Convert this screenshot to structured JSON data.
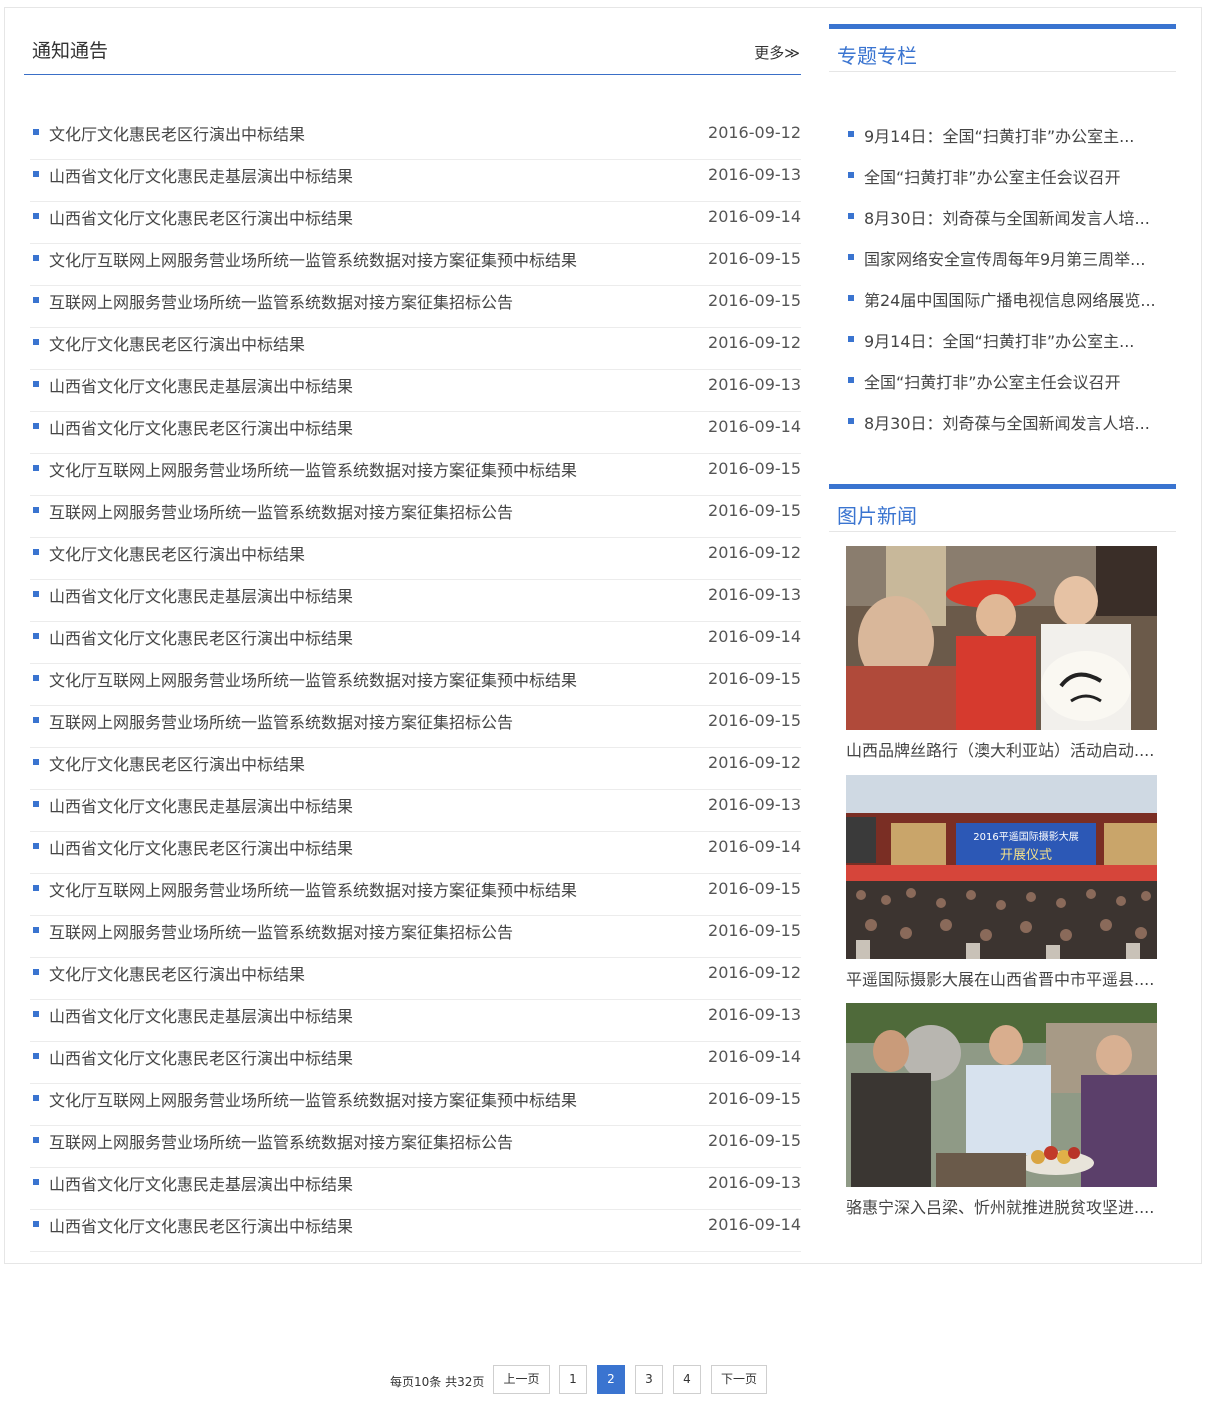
{
  "notices": {
    "title": "通知通告",
    "more_label": "更多≫",
    "items": [
      {
        "title": "文化厅文化惠民老区行演出中标结果",
        "date": "2016-09-12"
      },
      {
        "title": "山西省文化厅文化惠民走基层演出中标结果",
        "date": "2016-09-13"
      },
      {
        "title": "山西省文化厅文化惠民老区行演出中标结果",
        "date": "2016-09-14"
      },
      {
        "title": "文化厅互联网上网服务营业场所统一监管系统数据对接方案征集预中标结果",
        "date": "2016-09-15"
      },
      {
        "title": "互联网上网服务营业场所统一监管系统数据对接方案征集招标公告",
        "date": "2016-09-15"
      },
      {
        "title": "文化厅文化惠民老区行演出中标结果",
        "date": "2016-09-12"
      },
      {
        "title": "山西省文化厅文化惠民走基层演出中标结果",
        "date": "2016-09-13"
      },
      {
        "title": "山西省文化厅文化惠民老区行演出中标结果",
        "date": "2016-09-14"
      },
      {
        "title": "文化厅互联网上网服务营业场所统一监管系统数据对接方案征集预中标结果",
        "date": "2016-09-15"
      },
      {
        "title": "互联网上网服务营业场所统一监管系统数据对接方案征集招标公告",
        "date": "2016-09-15"
      },
      {
        "title": "文化厅文化惠民老区行演出中标结果",
        "date": "2016-09-12"
      },
      {
        "title": "山西省文化厅文化惠民走基层演出中标结果",
        "date": "2016-09-13"
      },
      {
        "title": "山西省文化厅文化惠民老区行演出中标结果",
        "date": "2016-09-14"
      },
      {
        "title": "文化厅互联网上网服务营业场所统一监管系统数据对接方案征集预中标结果",
        "date": "2016-09-15"
      },
      {
        "title": "互联网上网服务营业场所统一监管系统数据对接方案征集招标公告",
        "date": "2016-09-15"
      },
      {
        "title": "文化厅文化惠民老区行演出中标结果",
        "date": "2016-09-12"
      },
      {
        "title": "山西省文化厅文化惠民走基层演出中标结果",
        "date": "2016-09-13"
      },
      {
        "title": "山西省文化厅文化惠民老区行演出中标结果",
        "date": "2016-09-14"
      },
      {
        "title": "文化厅互联网上网服务营业场所统一监管系统数据对接方案征集预中标结果",
        "date": "2016-09-15"
      },
      {
        "title": "互联网上网服务营业场所统一监管系统数据对接方案征集招标公告",
        "date": "2016-09-15"
      },
      {
        "title": "文化厅文化惠民老区行演出中标结果",
        "date": "2016-09-12"
      },
      {
        "title": "山西省文化厅文化惠民走基层演出中标结果",
        "date": "2016-09-13"
      },
      {
        "title": "山西省文化厅文化惠民老区行演出中标结果",
        "date": "2016-09-14"
      },
      {
        "title": "文化厅互联网上网服务营业场所统一监管系统数据对接方案征集预中标结果",
        "date": "2016-09-15"
      },
      {
        "title": "互联网上网服务营业场所统一监管系统数据对接方案征集招标公告",
        "date": "2016-09-15"
      },
      {
        "title": "山西省文化厅文化惠民走基层演出中标结果",
        "date": "2016-09-13"
      },
      {
        "title": "山西省文化厅文化惠民老区行演出中标结果",
        "date": "2016-09-14"
      }
    ]
  },
  "topics": {
    "title": "专题专栏",
    "items": [
      "9月14日：全国“扫黄打非”办公室主...",
      "全国“扫黄打非”办公室主任会议召开",
      "8月30日：刘奇葆与全国新闻发言人培...",
      "国家网络安全宣传周每年9月第三周举...",
      "第24届中国国际广播电视信息网络展览...",
      "9月14日：全国“扫黄打非”办公室主...",
      "全国“扫黄打非”办公室主任会议召开",
      "8月30日：刘奇葆与全国新闻发言人培..."
    ]
  },
  "photo_news": {
    "title": "图片新闻",
    "items": [
      {
        "caption": "山西品牌丝路行（澳大利亚站）活动启动....",
        "image": "photo-crowd-celebration"
      },
      {
        "caption": "平遥国际摄影大展在山西省晋中市平遥县....",
        "image": "photo-stage-ceremony",
        "stage_text": "开展仪式",
        "banner_text": "2016平遥国际摄影大展"
      },
      {
        "caption": "骆惠宁深入吕梁、忻州就推进脱贫攻坚进....",
        "image": "photo-village-visit"
      }
    ]
  },
  "pagination": {
    "info": "每页10条 共32页",
    "prev_label": "上一页",
    "next_label": "下一页",
    "pages": [
      "1",
      "2",
      "3",
      "4"
    ],
    "current": "2"
  },
  "colors": {
    "accent": "#3a74d0",
    "divider": "#ececec"
  }
}
